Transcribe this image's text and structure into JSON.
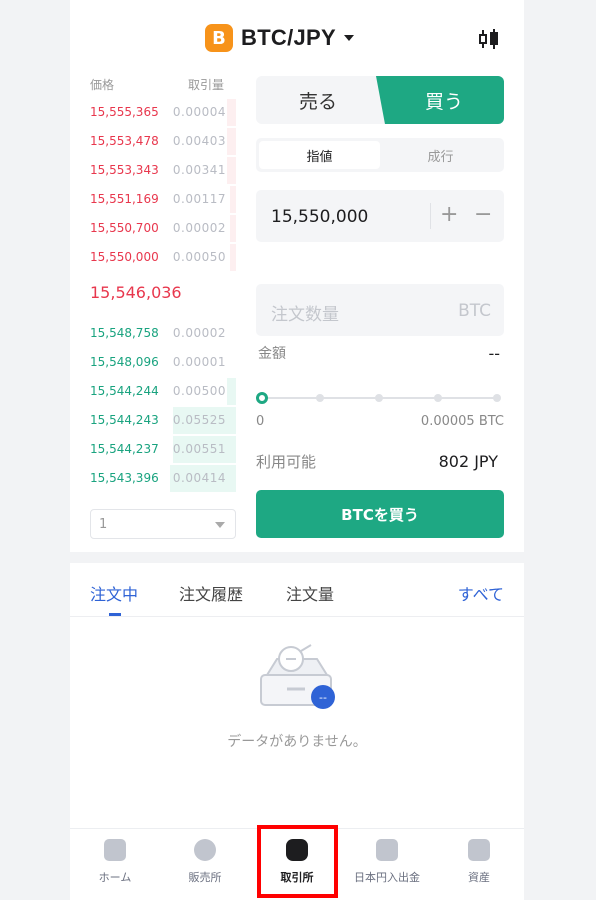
{
  "header": {
    "pair": "BTC/JPY",
    "coin_symbol": "B",
    "accent": "#f7931a",
    "chart_icon": "candlestick-chart-icon"
  },
  "orderbook": {
    "price_header": "価格",
    "qty_header": "取引量",
    "asks": [
      {
        "price": "15,555,365",
        "qty": "0.00004",
        "depth": 0.06
      },
      {
        "price": "15,553,478",
        "qty": "0.00403",
        "depth": 0.06
      },
      {
        "price": "15,553,343",
        "qty": "0.00341",
        "depth": 0.06
      },
      {
        "price": "15,551,169",
        "qty": "0.00117",
        "depth": 0.04
      },
      {
        "price": "15,550,700",
        "qty": "0.00002",
        "depth": 0.04
      },
      {
        "price": "15,550,000",
        "qty": "0.00050",
        "depth": 0.04
      }
    ],
    "last_price": "15,546,036",
    "bids": [
      {
        "price": "15,548,758",
        "qty": "0.00002",
        "depth": 0.0
      },
      {
        "price": "15,548,096",
        "qty": "0.00001",
        "depth": 0.0
      },
      {
        "price": "15,544,244",
        "qty": "0.00500",
        "depth": 0.06
      },
      {
        "price": "15,544,243",
        "qty": "0.05525",
        "depth": 0.43
      },
      {
        "price": "15,544,237",
        "qty": "0.00551",
        "depth": 0.43
      },
      {
        "price": "15,543,396",
        "qty": "0.00414",
        "depth": 0.45
      }
    ],
    "depth_select": "1"
  },
  "trade": {
    "sell_label": "売る",
    "buy_label": "買う",
    "limit_label": "指値",
    "market_label": "成行",
    "price_value": "15,550,000",
    "plus": "+",
    "minus": "−",
    "qty_placeholder": "注文数量",
    "qty_unit": "BTC",
    "amount_label": "金額",
    "amount_value": "--",
    "slider_min": "0",
    "slider_max": "0.00005 BTC",
    "slider_level": 0,
    "available_label": "利用可能",
    "available_value": "802 JPY",
    "submit_label": "BTCを買う",
    "buy_color": "#1ea883",
    "sell_color": "#e8374d"
  },
  "orders": {
    "tabs": [
      "注文中",
      "注文履歴",
      "注文量"
    ],
    "see_all": "すべて",
    "empty_text": "データがありません。",
    "empty_badge": "--"
  },
  "nav": {
    "items": [
      {
        "label": "ホーム",
        "icon": "home-icon"
      },
      {
        "label": "販売所",
        "icon": "exchange-wave-icon"
      },
      {
        "label": "取引所",
        "icon": "coin-stack-icon"
      },
      {
        "label": "日本円入出金",
        "icon": "deposit-withdraw-icon"
      },
      {
        "label": "資産",
        "icon": "wallet-icon"
      }
    ],
    "active": "取引所"
  }
}
